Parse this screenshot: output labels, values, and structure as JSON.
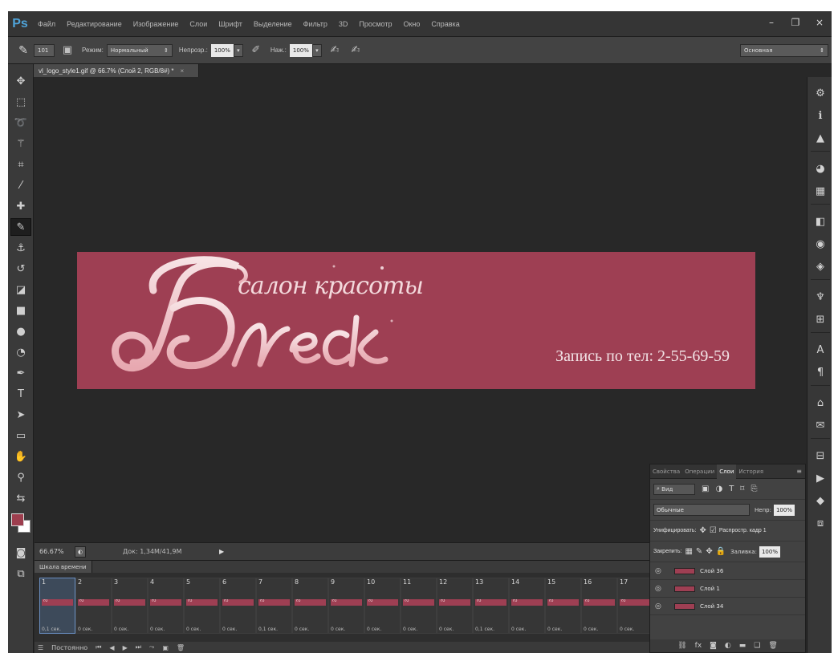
{
  "menubar": {
    "logo": "Ps",
    "items": [
      "Файл",
      "Редактирование",
      "Изображение",
      "Слои",
      "Шрифт",
      "Выделение",
      "Фильтр",
      "3D",
      "Просмотр",
      "Окно",
      "Справка"
    ],
    "window_controls": [
      "–",
      "❐",
      "×"
    ]
  },
  "options": {
    "brush_size": "101",
    "mode_label": "Режим:",
    "mode_value": "Нормальный",
    "opacity_label": "Непрозр.:",
    "opacity_value": "100%",
    "flow_label": "Наж.:",
    "flow_value": "100%",
    "workspace": "Основная"
  },
  "document": {
    "tab_title": "vl_logo_style1.gif @ 66.7% (Слой 2, RGB/8#) *",
    "tab_close": "×"
  },
  "banner": {
    "colors": {
      "background": "#9e3f53",
      "text": "#f3d9dc"
    },
    "slogan": "салон красоты",
    "phone": "Запись по тел: 2-55-69-59"
  },
  "status": {
    "zoom": "66.67%",
    "doc_info": "Док: 1,34М/41,9М"
  },
  "timeline": {
    "tab": "Шкала времени",
    "frames": [
      {
        "num": "1",
        "delay": "0,1 сек."
      },
      {
        "num": "2",
        "delay": "0 сек."
      },
      {
        "num": "3",
        "delay": "0 сек."
      },
      {
        "num": "4",
        "delay": "0 сек."
      },
      {
        "num": "5",
        "delay": "0 сек."
      },
      {
        "num": "6",
        "delay": "0 сек."
      },
      {
        "num": "7",
        "delay": "0,1 сек."
      },
      {
        "num": "8",
        "delay": "0 сек."
      },
      {
        "num": "9",
        "delay": "0 сек."
      },
      {
        "num": "10",
        "delay": "0 сек."
      },
      {
        "num": "11",
        "delay": "0 сек."
      },
      {
        "num": "12",
        "delay": "0 сек."
      },
      {
        "num": "13",
        "delay": "0,1 сек."
      },
      {
        "num": "14",
        "delay": "0 сек."
      },
      {
        "num": "15",
        "delay": "0 сек."
      },
      {
        "num": "16",
        "delay": "0 сек."
      },
      {
        "num": "17",
        "delay": "0 сек."
      }
    ],
    "loop": "Постоянно"
  },
  "layers_panel": {
    "tabs": [
      "Свойства",
      "Операции",
      "Слои",
      "История"
    ],
    "active_tab": "Слои",
    "filter": "Вид",
    "blend_mode": "Обычные",
    "opacity_label": "Непр:",
    "opacity_value": "100%",
    "unify_label": "Унифицировать:",
    "propagate_label": "Распростр. кадр 1",
    "lock_label": "Закрепить:",
    "fill_label": "Заливка:",
    "fill_value": "100%",
    "layers": [
      {
        "name": "Слой 36"
      },
      {
        "name": "Слой 1"
      },
      {
        "name": "Слой 34"
      }
    ]
  }
}
